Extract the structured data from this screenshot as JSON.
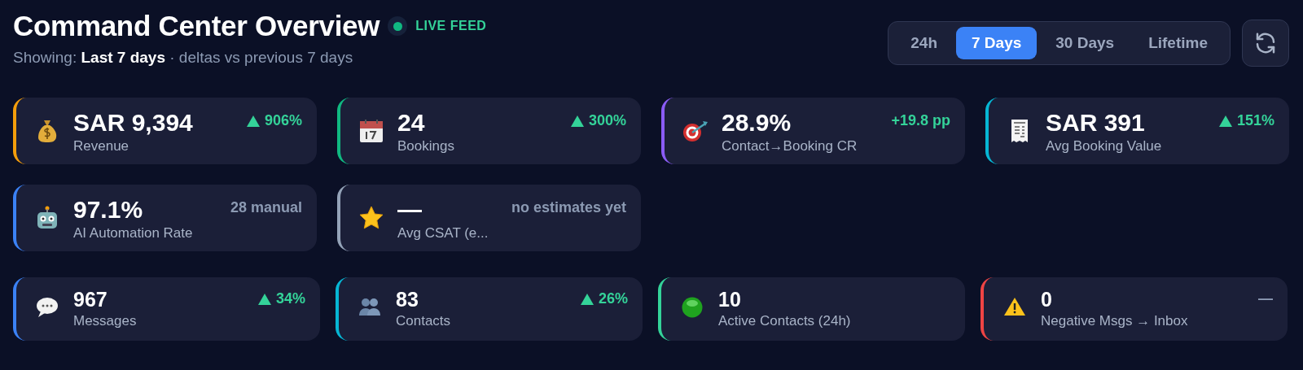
{
  "header": {
    "title": "Command Center Overview",
    "live_badge": "LIVE FEED",
    "subtitle": "Showing: **Last 7 days** · deltas vs previous 7 days"
  },
  "range_tabs": [
    {
      "label": "24h",
      "selected": false
    },
    {
      "label": "7 Days",
      "selected": true
    },
    {
      "label": "30 Days",
      "selected": false
    },
    {
      "label": "Lifetime",
      "selected": false
    }
  ],
  "primary_metrics": [
    {
      "value": "SAR 9,394",
      "label": "Revenue",
      "delta": "906%",
      "kind": "up",
      "color": "#f59e0b"
    },
    {
      "value": "24",
      "label": "Bookings",
      "delta": "300%",
      "kind": "up",
      "color": "#10b981"
    },
    {
      "value": "28.9%",
      "label": "Contact→Booking CR",
      "delta": "+19.8 pp",
      "kind": "positive",
      "color": "#8b5cf6"
    },
    {
      "value": "SAR 391",
      "label": "Avg Booking Value",
      "delta": "151%",
      "kind": "up",
      "color": "#06b6d4"
    },
    {
      "value": "97.1%",
      "label": "AI Automation Rate",
      "delta": "28 manual",
      "kind": "neutral",
      "color": "#3b82f6"
    },
    {
      "value": "—",
      "label": "Avg CSAT (e...",
      "delta": "no estimates yet",
      "kind": "neutral",
      "color": "#94a3b8"
    }
  ],
  "secondary_metrics": [
    {
      "value": "967",
      "label": "Messages",
      "delta": "34%",
      "kind": "up",
      "color": "#3b82f6"
    },
    {
      "value": "83",
      "label": "Contacts",
      "delta": "26%",
      "kind": "up",
      "color": "#06b6d4"
    },
    {
      "value": "10",
      "label": "Active Contacts (24h)",
      "color": "#34d399"
    },
    {
      "value": "0",
      "label": "Negative Msgs → Inbox",
      "delta": "—",
      "kind": "neutral",
      "color": "#ef4444"
    }
  ]
}
